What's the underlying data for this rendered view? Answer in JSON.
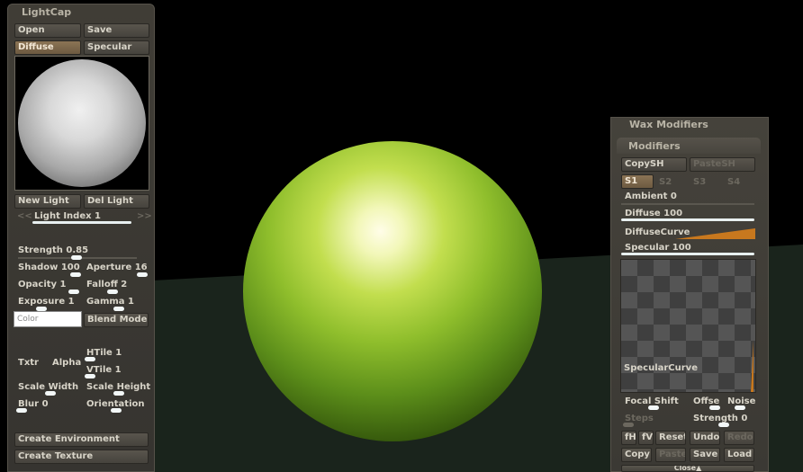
{
  "lightcap": {
    "title": "LightCap",
    "open": "Open",
    "save": "Save",
    "diffuse": "Diffuse",
    "specular": "Specular",
    "new_light": "New Light",
    "del_light": "Del Light",
    "light_index": "Light Index 1",
    "strength": "Strength 0.85",
    "shadow": "Shadow 100",
    "aperture": "Aperture 16",
    "opacity": "Opacity 1",
    "falloff": "Falloff 2",
    "exposure": "Exposure 1",
    "gamma": "Gamma 1",
    "color_placeholder": "Color",
    "blend_mode": "Blend Mode",
    "txtr": "Txtr",
    "alpha": "Alpha",
    "htile": "HTile 1",
    "vtile": "VTile 1",
    "scale_width": "Scale Width",
    "scale_height": "Scale Height",
    "blur": "Blur 0",
    "orientation": "Orientation",
    "create_environment": "Create Environment",
    "create_texture": "Create Texture"
  },
  "wax": {
    "title": "Wax Modifiers",
    "modifiers": "Modifiers",
    "copysh": "CopySH",
    "pastesh": "PasteSH",
    "s1": "S1",
    "s2": "S2",
    "s3": "S3",
    "s4": "S4",
    "ambient": "Ambient 0",
    "diffuse": "Diffuse 100",
    "diffuse_curve": "DiffuseCurve",
    "specular": "Specular 100",
    "specular_curve": "SpecularCurve",
    "focal_shift": "Focal Shift",
    "offse": "Offse",
    "noise": "Noise",
    "steps": "Steps",
    "strength": "Strength 0",
    "fh": "fH",
    "fv": "fV",
    "reset": "Reset",
    "undo": "Undo",
    "redo": "Redo",
    "copy": "Copy",
    "paste": "Paste",
    "save": "Save",
    "load": "Load",
    "close": "Close▲"
  },
  "colors": {
    "accent_active": "#8b7455",
    "slider": "#e8f0f0",
    "curve": "#c8781e",
    "sphere": "#8fbe2c"
  }
}
